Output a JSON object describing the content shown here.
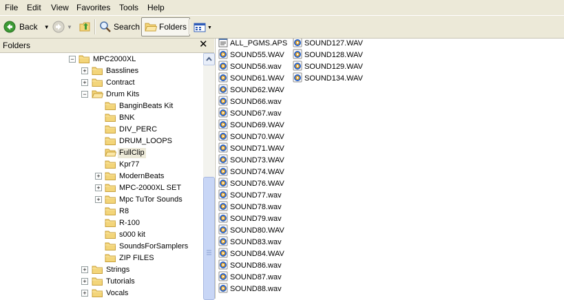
{
  "menu": [
    "File",
    "Edit",
    "View",
    "Favorites",
    "Tools",
    "Help"
  ],
  "toolbar": {
    "back_label": "Back",
    "search_label": "Search",
    "folders_label": "Folders"
  },
  "folders_pane": {
    "title": "Folders",
    "tree": [
      {
        "label": "MPC2000XL",
        "level": 0,
        "expander": "minus"
      },
      {
        "label": "Basslines",
        "level": 1,
        "expander": "plus"
      },
      {
        "label": "Contract",
        "level": 1,
        "expander": "plus"
      },
      {
        "label": "Drum Kits",
        "level": 1,
        "expander": "minus",
        "open": true
      },
      {
        "label": "BanginBeats Kit",
        "level": 2,
        "expander": "none"
      },
      {
        "label": "BNK",
        "level": 2,
        "expander": "none"
      },
      {
        "label": "DIV_PERC",
        "level": 2,
        "expander": "none"
      },
      {
        "label": "DRUM_LOOPS",
        "level": 2,
        "expander": "none"
      },
      {
        "label": "FullClip",
        "level": 2,
        "expander": "none",
        "selected": true,
        "open": true
      },
      {
        "label": "Kpr77",
        "level": 2,
        "expander": "none"
      },
      {
        "label": "ModernBeats",
        "level": 2,
        "expander": "plus"
      },
      {
        "label": "MPC-2000XL SET",
        "level": 2,
        "expander": "plus"
      },
      {
        "label": "Mpc TuTor Sounds",
        "level": 2,
        "expander": "plus"
      },
      {
        "label": "R8",
        "level": 2,
        "expander": "none"
      },
      {
        "label": "R-100",
        "level": 2,
        "expander": "none"
      },
      {
        "label": "s000 kit",
        "level": 2,
        "expander": "none"
      },
      {
        "label": "SoundsForSamplers",
        "level": 2,
        "expander": "none"
      },
      {
        "label": "ZIP FILES",
        "level": 2,
        "expander": "none"
      },
      {
        "label": "Strings",
        "level": 1,
        "expander": "plus"
      },
      {
        "label": "Tutorials",
        "level": 1,
        "expander": "plus"
      },
      {
        "label": "Vocals",
        "level": 1,
        "expander": "plus"
      }
    ]
  },
  "files": {
    "columns": [
      [
        {
          "name": "ALL_PGMS.APS",
          "type": "aps"
        },
        {
          "name": "SOUND55.WAV",
          "type": "wav"
        },
        {
          "name": "SOUND56.wav",
          "type": "wav"
        },
        {
          "name": "SOUND61.WAV",
          "type": "wav"
        },
        {
          "name": "SOUND62.WAV",
          "type": "wav"
        },
        {
          "name": "SOUND66.wav",
          "type": "wav"
        },
        {
          "name": "SOUND67.wav",
          "type": "wav"
        },
        {
          "name": "SOUND69.WAV",
          "type": "wav"
        },
        {
          "name": "SOUND70.WAV",
          "type": "wav"
        },
        {
          "name": "SOUND71.WAV",
          "type": "wav"
        },
        {
          "name": "SOUND73.WAV",
          "type": "wav"
        },
        {
          "name": "SOUND74.WAV",
          "type": "wav"
        },
        {
          "name": "SOUND76.WAV",
          "type": "wav"
        },
        {
          "name": "SOUND77.wav",
          "type": "wav"
        },
        {
          "name": "SOUND78.wav",
          "type": "wav"
        },
        {
          "name": "SOUND79.wav",
          "type": "wav"
        },
        {
          "name": "SOUND80.WAV",
          "type": "wav"
        },
        {
          "name": "SOUND83.wav",
          "type": "wav"
        },
        {
          "name": "SOUND84.WAV",
          "type": "wav"
        },
        {
          "name": "SOUND86.wav",
          "type": "wav"
        },
        {
          "name": "SOUND87.wav",
          "type": "wav"
        },
        {
          "name": "SOUND88.wav",
          "type": "wav"
        }
      ],
      [
        {
          "name": "SOUND127.WAV",
          "type": "wav"
        },
        {
          "name": "SOUND128.WAV",
          "type": "wav"
        },
        {
          "name": "SOUND129.WAV",
          "type": "wav"
        },
        {
          "name": "SOUND134.WAV",
          "type": "wav"
        }
      ]
    ]
  },
  "colors": {
    "chrome": "#ece9d8",
    "folder": "#f3d57a",
    "folder_edge": "#c8a03a",
    "back_green": "#3c9a34"
  }
}
